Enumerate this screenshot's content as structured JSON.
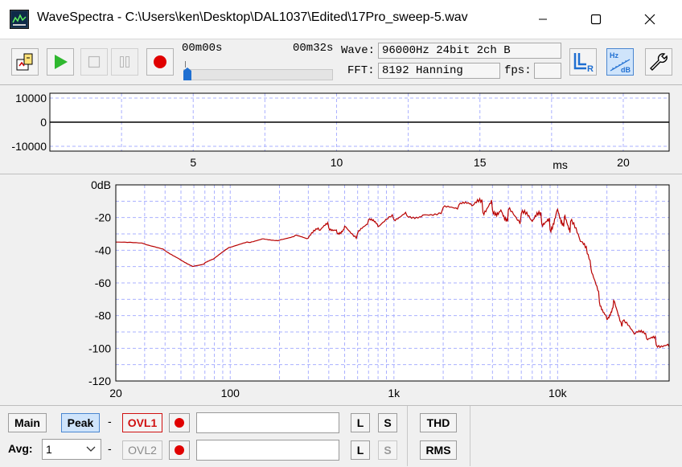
{
  "window": {
    "app_name": "WaveSpectra",
    "title": "WaveSpectra - C:\\Users\\ken\\Desktop\\DAL1037\\Edited\\17Pro_sweep-5.wav"
  },
  "toolbar": {
    "time_start": "00m00s",
    "time_end": "00m32s",
    "position_fraction": 0.0,
    "wave_label": "Wave:",
    "wave_value": "96000Hz 24bit 2ch B",
    "fft_label": "FFT:",
    "fft_value": "8192 Hanning",
    "fps_label": "fps:",
    "fps_value": "",
    "lr_icon_text": "R",
    "hzdb_top": "Hz",
    "hzdb_bottom": "dB"
  },
  "waveform": {
    "y_ticks": [
      "10000",
      "0",
      "-10000"
    ],
    "x_ticks": [
      "5",
      "10",
      "15",
      "20"
    ],
    "x_tick_values": [
      5,
      10,
      15,
      20
    ],
    "x_unit": "ms",
    "xlim": [
      0,
      21.6
    ],
    "ylim": [
      -12000,
      12000
    ]
  },
  "spectrum": {
    "y_ticks": [
      "0dB",
      "-20",
      "-40",
      "-60",
      "-80",
      "-100",
      "-120"
    ],
    "y_tick_values": [
      0,
      -20,
      -40,
      -60,
      -80,
      -100,
      -120
    ],
    "x_ticks": [
      "20",
      "100",
      "1k",
      "10k"
    ],
    "x_tick_values": [
      20,
      100,
      1000,
      10000
    ],
    "xlim": [
      20,
      48000
    ],
    "ylim": [
      -120,
      0
    ],
    "trace_color": "#b80000"
  },
  "chart_data": {
    "type": "line",
    "title": "",
    "xlabel": "",
    "ylabel": "",
    "x_scale": "log",
    "xlim": [
      20,
      48000
    ],
    "ylim": [
      -120,
      0
    ],
    "grid": true,
    "series": [
      {
        "x": [
          20,
          30,
          40,
          50,
          60,
          70,
          80,
          100,
          130,
          160,
          200,
          250,
          300,
          350,
          400,
          450,
          500,
          600,
          700,
          800,
          1000,
          1200,
          1500,
          2000,
          2500,
          3000,
          3500,
          4000,
          4500,
          5000,
          6000,
          7000,
          8000,
          9000,
          10000,
          11000,
          12000,
          14000,
          16000,
          18000,
          20000,
          22000,
          25000,
          30000,
          35000,
          40000,
          48000
        ],
        "values": [
          -35,
          -36,
          -40,
          -46,
          -50,
          -48,
          -45,
          -38,
          -35,
          -33,
          -34,
          -31,
          -33,
          -27,
          -25,
          -29,
          -26,
          -31,
          -22,
          -25,
          -20,
          -18,
          -19,
          -15,
          -13,
          -12,
          -14,
          -13,
          -16,
          -18,
          -20,
          -22,
          -21,
          -25,
          -15,
          -22,
          -25,
          -35,
          -50,
          -70,
          -82,
          -72,
          -85,
          -91,
          -93,
          -96,
          -99
        ]
      }
    ]
  },
  "bottom": {
    "main_label": "Main",
    "peak_label": "Peak",
    "dash": "-",
    "ovl1_label": "OVL1",
    "ovl2_label": "OVL2",
    "avg_label": "Avg:",
    "avg_value": "1",
    "l_label": "L",
    "s_label": "S",
    "thd_label": "THD",
    "rms_label": "RMS"
  },
  "colors": {
    "accent": "#1f6fd1",
    "record_red": "#e00000",
    "play_green": "#2fb82f",
    "grid_blue": "#aab0ff"
  }
}
